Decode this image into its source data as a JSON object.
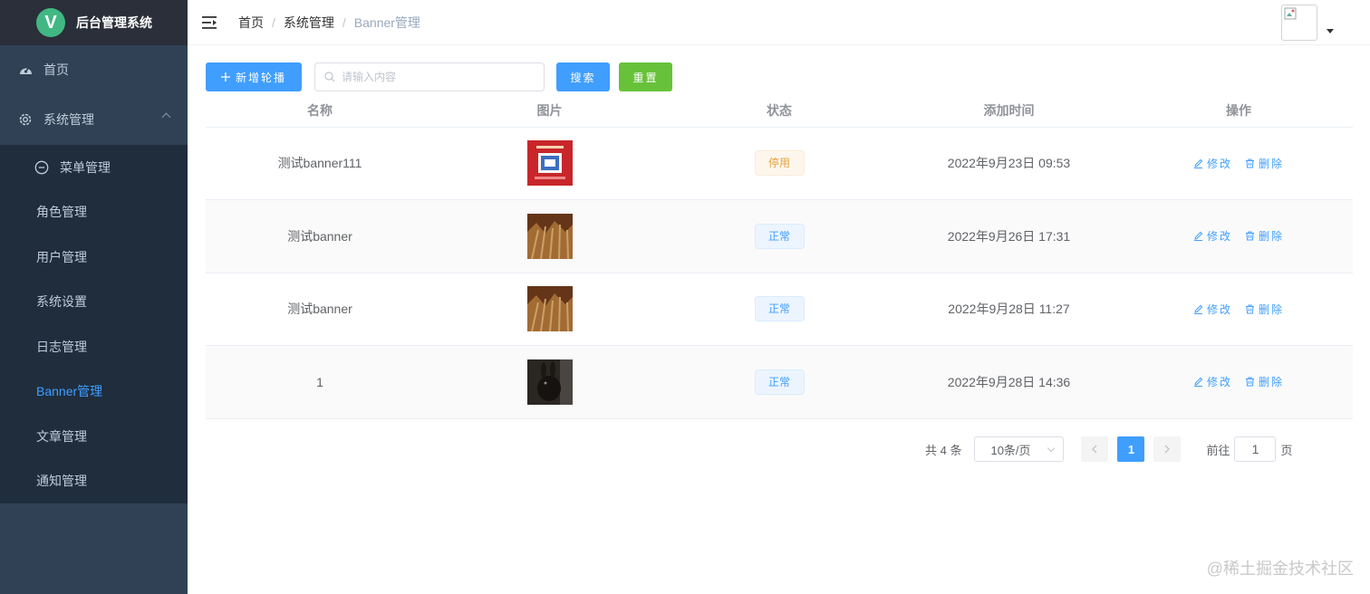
{
  "app": {
    "title": "后台管理系统",
    "logo_letter": "V"
  },
  "sidebar": {
    "items": [
      {
        "label": "首页",
        "icon": "dashboard-icon"
      },
      {
        "label": "系统管理",
        "icon": "gear-icon",
        "expanded": true
      }
    ],
    "submenu": [
      {
        "label": "菜单管理",
        "icon": "minus-circle-icon"
      },
      {
        "label": "角色管理"
      },
      {
        "label": "用户管理"
      },
      {
        "label": "系统设置"
      },
      {
        "label": "日志管理"
      },
      {
        "label": "Banner管理",
        "active": true
      },
      {
        "label": "文章管理"
      },
      {
        "label": "通知管理"
      }
    ]
  },
  "header": {
    "breadcrumb": [
      "首页",
      "系统管理",
      "Banner管理"
    ],
    "breadcrumb_sep": "/"
  },
  "toolbar": {
    "add_label": "新增轮播",
    "search_placeholder": "请输入内容",
    "search_label": "搜索",
    "reset_label": "重置"
  },
  "table": {
    "columns": [
      "名称",
      "图片",
      "状态",
      "添加时间",
      "操作"
    ],
    "rows": [
      {
        "name": "测试banner111",
        "image": "red-poster-thumbnail",
        "status": "停用",
        "status_type": "warning",
        "time": "2022年9月23日 09:53"
      },
      {
        "name": "测试banner",
        "image": "wheat-field-thumbnail",
        "status": "正常",
        "status_type": "normal",
        "time": "2022年9月26日 17:31"
      },
      {
        "name": "测试banner",
        "image": "wheat-field-thumbnail",
        "status": "正常",
        "status_type": "normal",
        "time": "2022年9月28日 11:27"
      },
      {
        "name": "1",
        "image": "dark-animal-thumbnail",
        "status": "正常",
        "status_type": "normal",
        "time": "2022年9月28日 14:36"
      }
    ],
    "edit_label": "修改",
    "delete_label": "删除"
  },
  "pagination": {
    "total_text": "共 4 条",
    "page_size": "10条/页",
    "current_page": "1",
    "goto_label": "前往",
    "goto_value": "1",
    "page_unit": "页"
  },
  "watermark": "@稀土掘金技术社区",
  "colors": {
    "primary": "#409eff",
    "success": "#67c23a",
    "warning": "#e6a23c",
    "sidebar_bg": "#304156",
    "submenu_bg": "#1f2d3d"
  }
}
